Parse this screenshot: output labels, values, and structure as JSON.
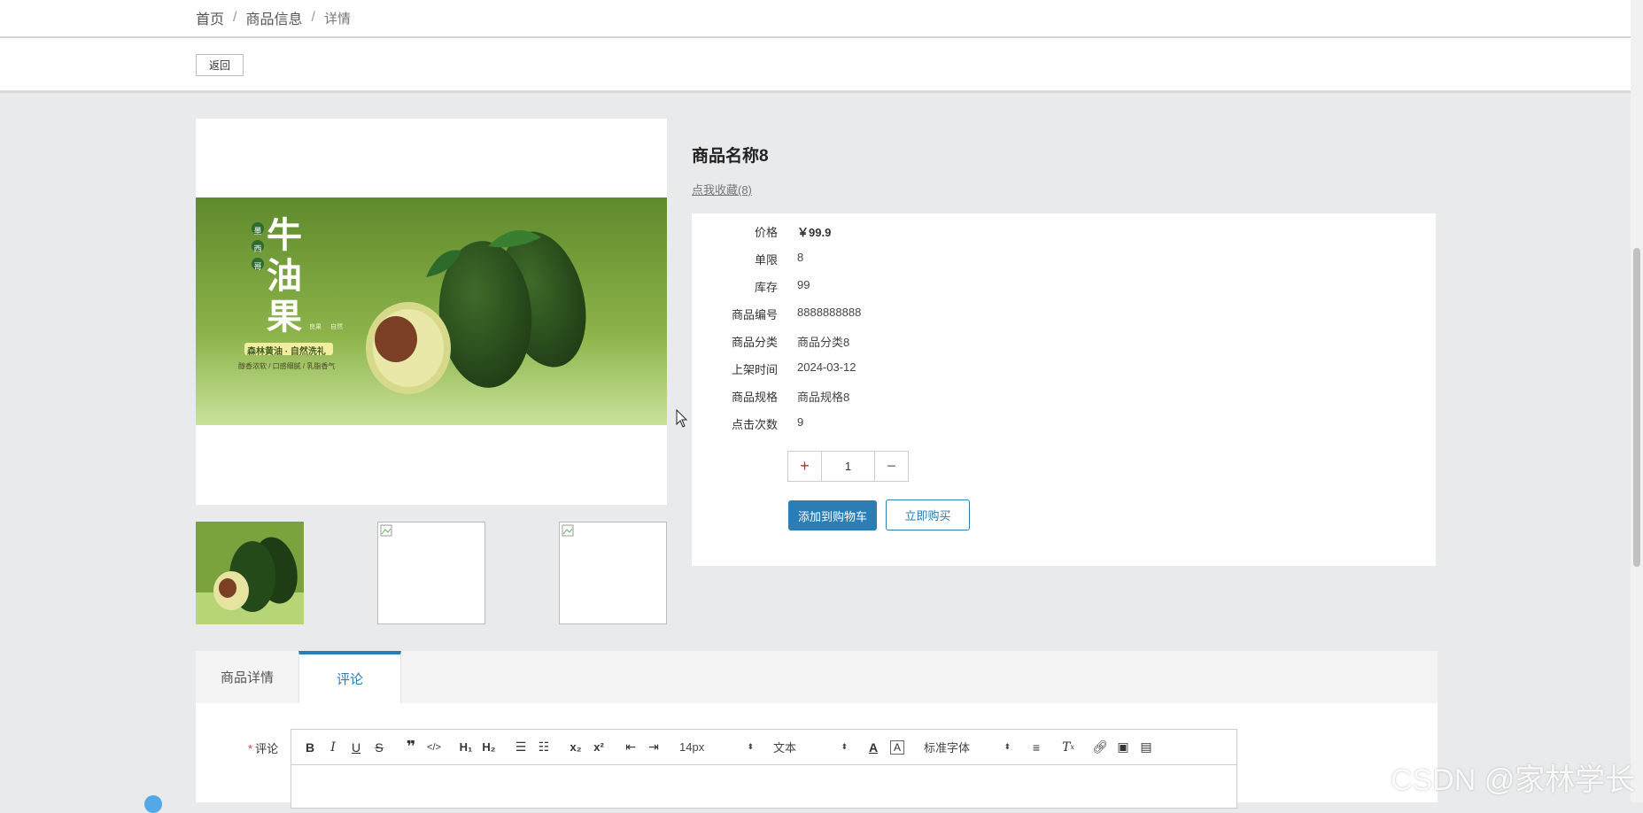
{
  "breadcrumb": {
    "home": "首页",
    "section": "商品信息",
    "current": "详情"
  },
  "back_label": "返回",
  "hero": {
    "title": "牛油果",
    "origin": "墨西哥",
    "tag1": "良果",
    "tag2": "自然",
    "slogan": "森林黄油 · 自然洗礼",
    "features": "醇香浓软 / 口感细腻 / 乳脂香气"
  },
  "product": {
    "title": "商品名称8",
    "fav_link": "点我收藏(8)",
    "fields": [
      {
        "label": "价格",
        "value": "￥99.9"
      },
      {
        "label": "单限",
        "value": "8"
      },
      {
        "label": "库存",
        "value": "99"
      },
      {
        "label": "商品编号",
        "value": "8888888888"
      },
      {
        "label": "商品分类",
        "value": "商品分类8"
      },
      {
        "label": "上架时间",
        "value": "2024-03-12"
      },
      {
        "label": "商品规格",
        "value": "商品规格8"
      },
      {
        "label": "点击次数",
        "value": "9"
      }
    ],
    "quantity": "1",
    "add_to_cart": "添加到购物车",
    "buy_now": "立即购买"
  },
  "tabs": {
    "detail": "商品详情",
    "comment": "评论"
  },
  "comment": {
    "label": "评论",
    "toolbar": {
      "font_size": "14px",
      "block_type": "文本",
      "font_family": "标准字体"
    }
  },
  "watermark": "CSDN @家林学长",
  "colors": {
    "accent": "#2b7db5",
    "page_bg": "#e9eaeb"
  }
}
